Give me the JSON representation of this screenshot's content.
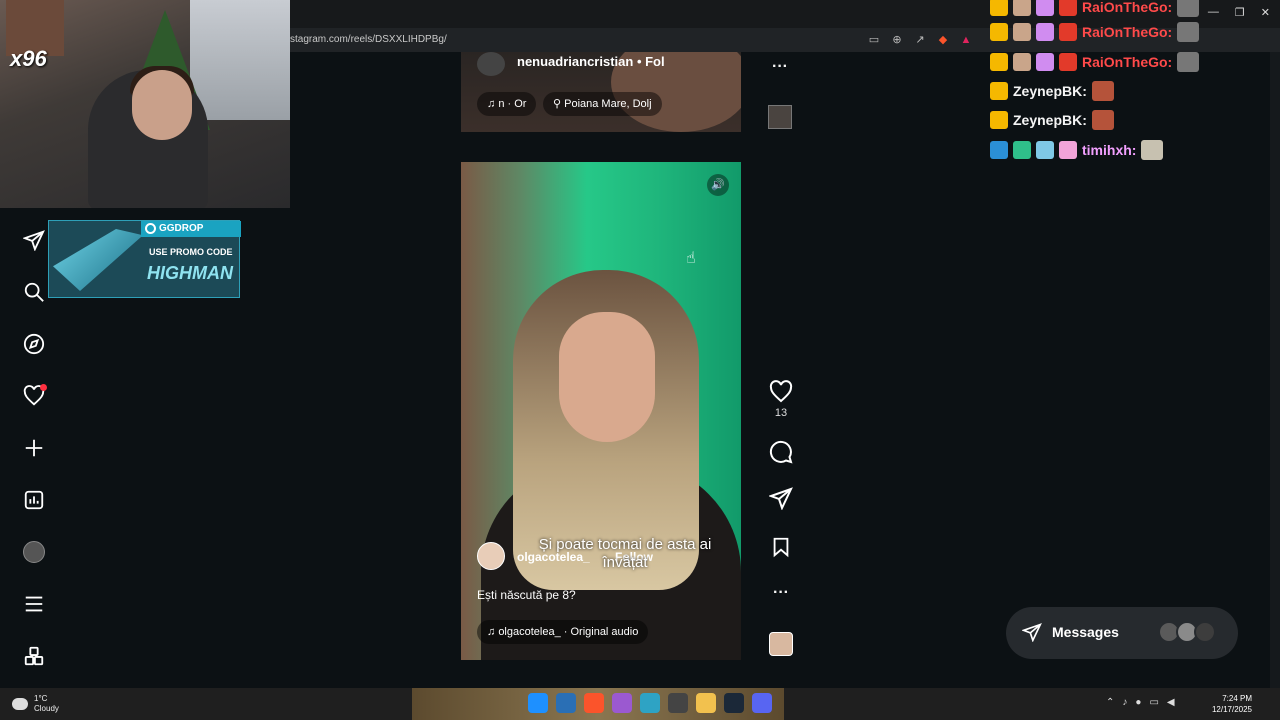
{
  "browser": {
    "url": "stagram.com/reels/DSXXLIHDPBg/",
    "toolbar_icons": [
      "cast-icon",
      "zoom-icon",
      "share-icon",
      "brave-shield-icon",
      "warning-icon"
    ]
  },
  "webcam": {
    "multiplier": "x96"
  },
  "promo": {
    "brand": "GGDROP",
    "line1": "USE PROMO CODE",
    "line2": "HIGHMAN"
  },
  "nav": {
    "items": [
      {
        "name": "messages-nav-icon"
      },
      {
        "name": "search-icon"
      },
      {
        "name": "explore-icon"
      },
      {
        "name": "notifications-heart-icon"
      },
      {
        "name": "create-plus-icon"
      },
      {
        "name": "insights-chart-icon"
      },
      {
        "name": "profile-avatar"
      },
      {
        "name": "menu-icon"
      },
      {
        "name": "apps-grid-icon"
      }
    ]
  },
  "post_top": {
    "username": "nenuadriancristian",
    "follow": "Fol",
    "audio": "n · Or",
    "location": "Poiana Mare, Dolj"
  },
  "reel": {
    "username": "olgacotelea_",
    "follow": "Follow",
    "overlay_text": "Și poate tocmai de asta ai învățat",
    "caption": "Ești născută pe 8?",
    "audio": "olgacotelea_ · Original audio",
    "likes": "13"
  },
  "chat": {
    "rows": [
      {
        "name": "RaiOnTheGo:",
        "color": "#ff4a4a"
      },
      {
        "name": "RaiOnTheGo:",
        "color": "#ff4a4a"
      },
      {
        "name": "RaiOnTheGo:",
        "color": "#ff4a4a"
      },
      {
        "name": "ZeynepBK:",
        "color": "#ffffff"
      },
      {
        "name": "ZeynepBK:",
        "color": "#ffffff"
      },
      {
        "name": "timihxh:",
        "color": "#f3a0ff"
      }
    ]
  },
  "messages": {
    "label": "Messages"
  },
  "taskbar": {
    "weather_temp": "1°C",
    "weather_desc": "Cloudy",
    "time": "7:24 PM",
    "date": "12/17/2025"
  }
}
